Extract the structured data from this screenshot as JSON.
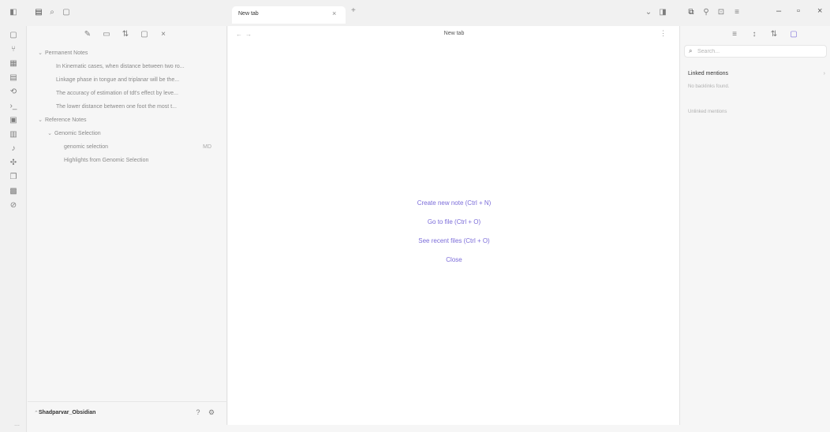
{
  "tabs": [
    {
      "label": "New tab",
      "close": "×"
    }
  ],
  "tab_new": "+",
  "main": {
    "nav_back": "←",
    "nav_forward": "→",
    "title": "New tab",
    "menu": "⋮",
    "actions": [
      "Create new note (Ctrl + N)",
      "Go to file (Ctrl + O)",
      "See recent files (Ctrl + O)",
      "Close"
    ]
  },
  "sidebar": {
    "tree": [
      {
        "label": "Permanent Notes",
        "chevron": "⌄",
        "level": 0
      },
      {
        "label": "In Kinematic cases, when distance between two ro...",
        "level": 2
      },
      {
        "label": "Linkage phase in tongue and triplanar will be the...",
        "level": 2
      },
      {
        "label": "The accuracy of estimation of tdt's effect by leve...",
        "level": 2
      },
      {
        "label": "The lower distance between one foot the most t...",
        "level": 2
      },
      {
        "label": "Reference Notes",
        "chevron": "⌄",
        "level": 0
      },
      {
        "label": "Genomic Selection",
        "chevron": "⌄",
        "level": 1
      },
      {
        "label": "genomic selection",
        "level": 3,
        "count": "MD"
      },
      {
        "label": "Highlights from Genomic Selection",
        "level": 3
      }
    ],
    "vault_name": "Shadparvar_Obsidian"
  },
  "right_sidebar": {
    "search_placeholder": "Search...",
    "linked_mentions": "Linked mentions",
    "no_backlinks": "No backlinks found.",
    "unlinked_mentions": "Unlinked mentions"
  }
}
